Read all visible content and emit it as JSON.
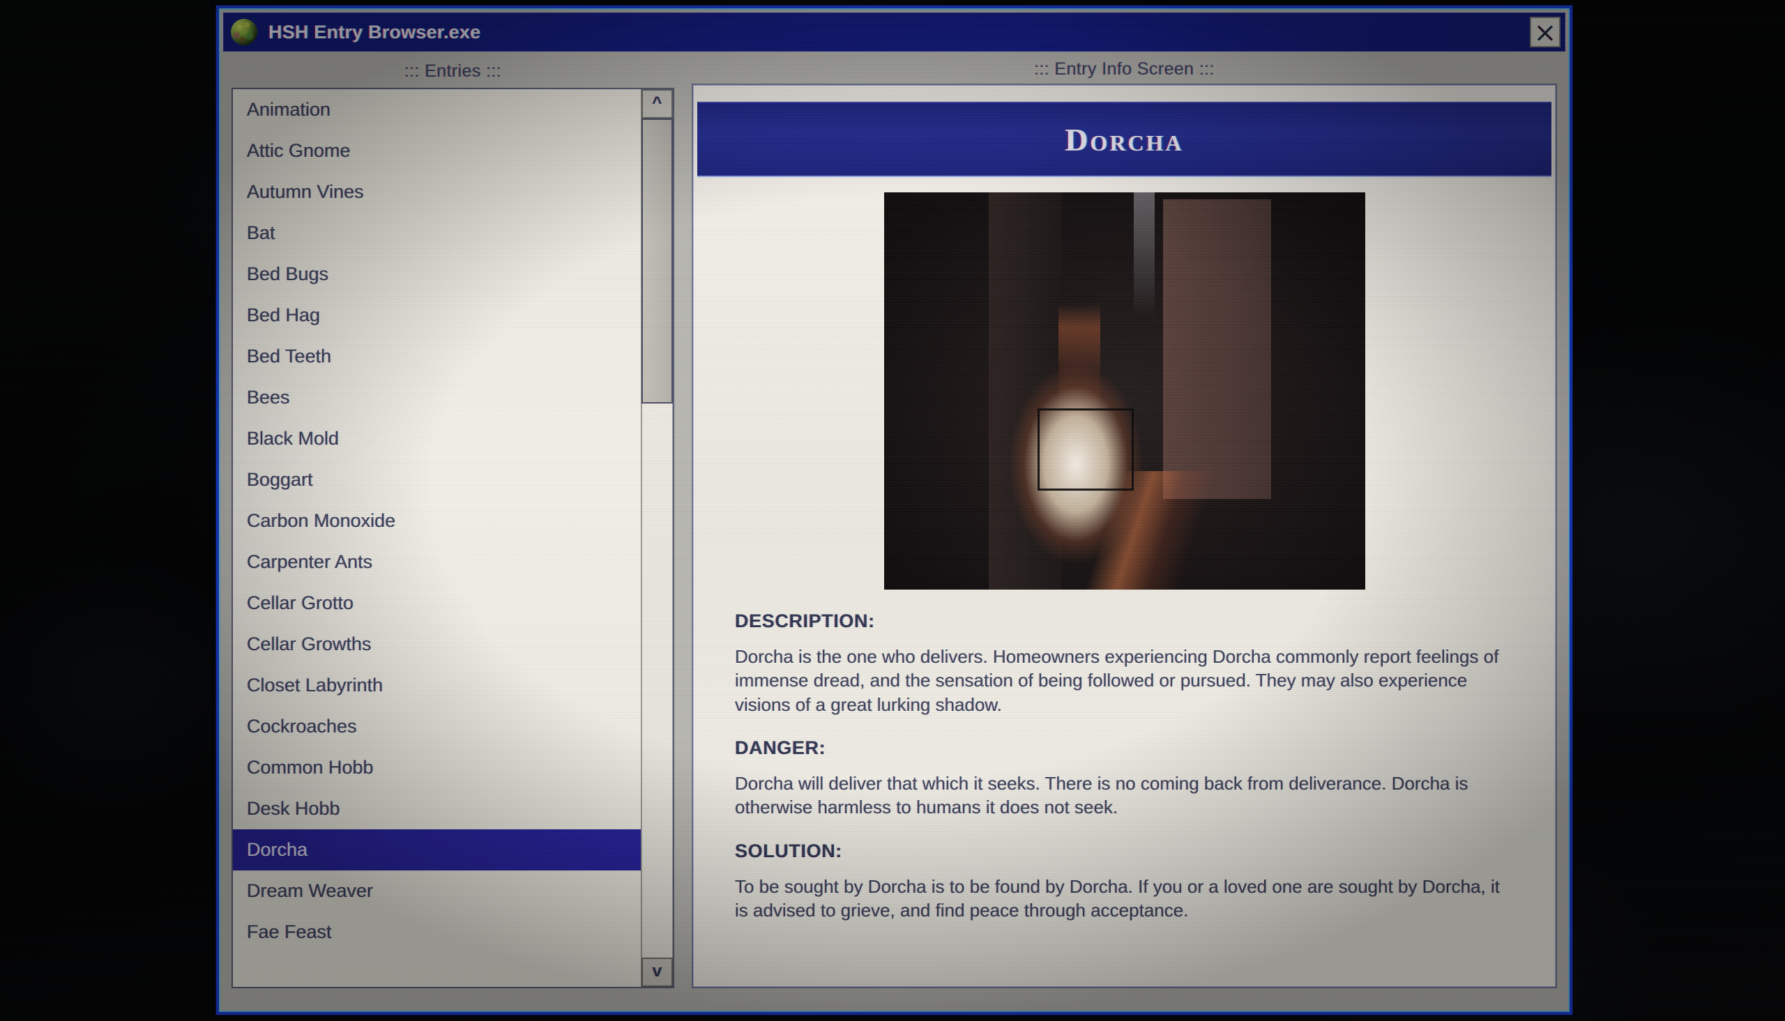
{
  "window": {
    "title": "HSH Entry Browser.exe",
    "icon": "mossy-orb-icon",
    "close_label": "X",
    "accent_border": "#1b3fd6",
    "titlebar_color": "#121a8a"
  },
  "entries_panel": {
    "header": "::: Entries :::",
    "selected": "Dorcha",
    "items": [
      "Animation",
      "Attic Gnome",
      "Autumn Vines",
      "Bat",
      "Bed Bugs",
      "Bed Hag",
      "Bed Teeth",
      "Bees",
      "Black Mold",
      "Boggart",
      "Carbon Monoxide",
      "Carpenter Ants",
      "Cellar Grotto",
      "Cellar Growths",
      "Closet Labyrinth",
      "Cockroaches",
      "Common Hobb",
      "Desk Hobb",
      "Dorcha",
      "Dream Weaver",
      "Fae Feast"
    ],
    "scrollbar": {
      "up_arrow": "^",
      "down_arrow": "v"
    }
  },
  "info_panel": {
    "header": "::: Entry Info Screen :::",
    "entry_title": "Dorcha",
    "entry_image_alt": "dark-doorway-photo",
    "banner_color": "#1f2790",
    "sections": [
      {
        "heading": "DESCRIPTION:",
        "body": "Dorcha is the one who delivers. Homeowners experiencing Dorcha commonly report feelings of immense dread, and the sensation of being followed or pursued. They may also experience visions of a great lurking shadow."
      },
      {
        "heading": "DANGER:",
        "body": "Dorcha will deliver that which it seeks. There is no coming back from deliverance. Dorcha is otherwise harmless to humans it does not seek."
      },
      {
        "heading": "SOLUTION:",
        "body": "To be sought by Dorcha is to be found by Dorcha. If you or a loved one are sought by Dorcha, it is advised to grieve, and find peace through acceptance."
      }
    ]
  }
}
